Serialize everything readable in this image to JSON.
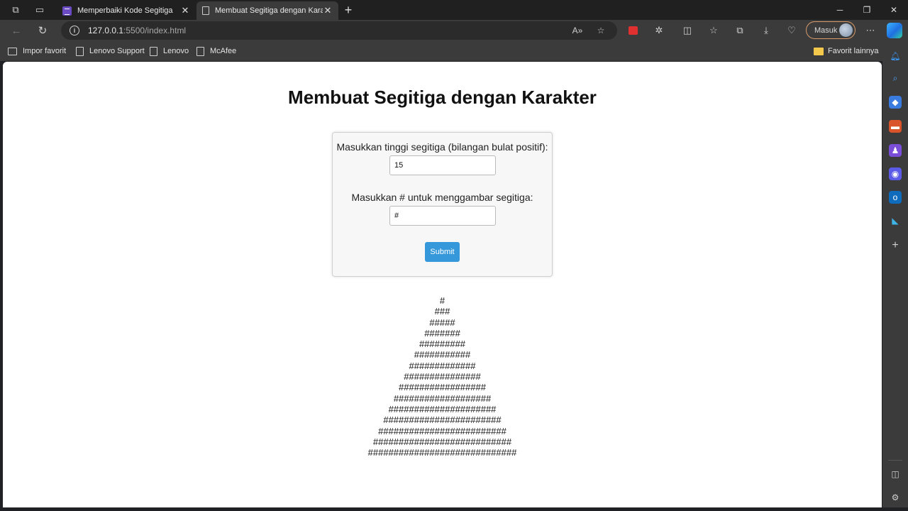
{
  "browser": {
    "tabs": [
      {
        "title": "Memperbaiki Kode Segitiga",
        "active": false
      },
      {
        "title": "Membuat Segitiga dengan Karakter",
        "active": true
      }
    ],
    "url_host": "127.0.0.1",
    "url_rest": ":5500/index.html",
    "signin_label": "Masuk",
    "favorites": [
      {
        "label": "Impor favorit",
        "icon": "import-icon"
      },
      {
        "label": "Lenovo Support",
        "icon": "page-icon"
      },
      {
        "label": "Lenovo",
        "icon": "page-icon"
      },
      {
        "label": "McAfee",
        "icon": "page-icon"
      }
    ],
    "other_favorites": "Favorit lainnya",
    "accent_color": "#d69a6b"
  },
  "page": {
    "title": "Membuat Segitiga dengan Karakter",
    "height_label": "Masukkan tinggi segitiga (bilangan bulat positif):",
    "height_value": "15",
    "char_label": "Masukkan # untuk menggambar segitiga:",
    "char_value": "#",
    "submit_label": "Submit",
    "submit_color": "#3498db",
    "triangle_rows": [
      "#",
      "###",
      "#####",
      "#######",
      "#########",
      "###########",
      "#############",
      "###############",
      "#################",
      "###################",
      "#####################",
      "#######################",
      "#########################",
      "###########################",
      "#############################"
    ]
  }
}
